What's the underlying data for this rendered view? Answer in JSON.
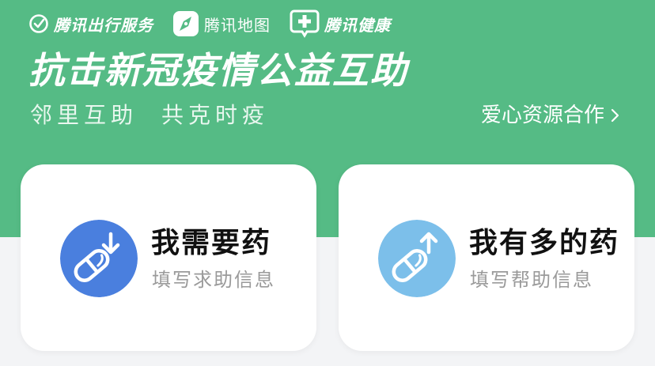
{
  "colors": {
    "hero_bg": "#55bb85",
    "page_bg": "#f3f4f6",
    "need_badge": "#4a7fde",
    "have_badge": "#7cbfea"
  },
  "partners": [
    {
      "label": "腾讯出行服务",
      "icon": "check-circle-icon"
    },
    {
      "label": "腾讯地图",
      "icon": "map-compass-icon"
    },
    {
      "label": "腾讯健康",
      "icon": "medical-plus-icon"
    }
  ],
  "header": {
    "title": "抗击新冠疫情公益互助",
    "slogan_left": "邻里互助",
    "slogan_right": "共克时疫",
    "cooperate_link": "爱心资源合作"
  },
  "cards": [
    {
      "title": "我需要药",
      "subtitle": "填写求助信息",
      "icon": "pill-download-icon"
    },
    {
      "title": "我有多的药",
      "subtitle": "填写帮助信息",
      "icon": "pill-upload-icon"
    }
  ]
}
